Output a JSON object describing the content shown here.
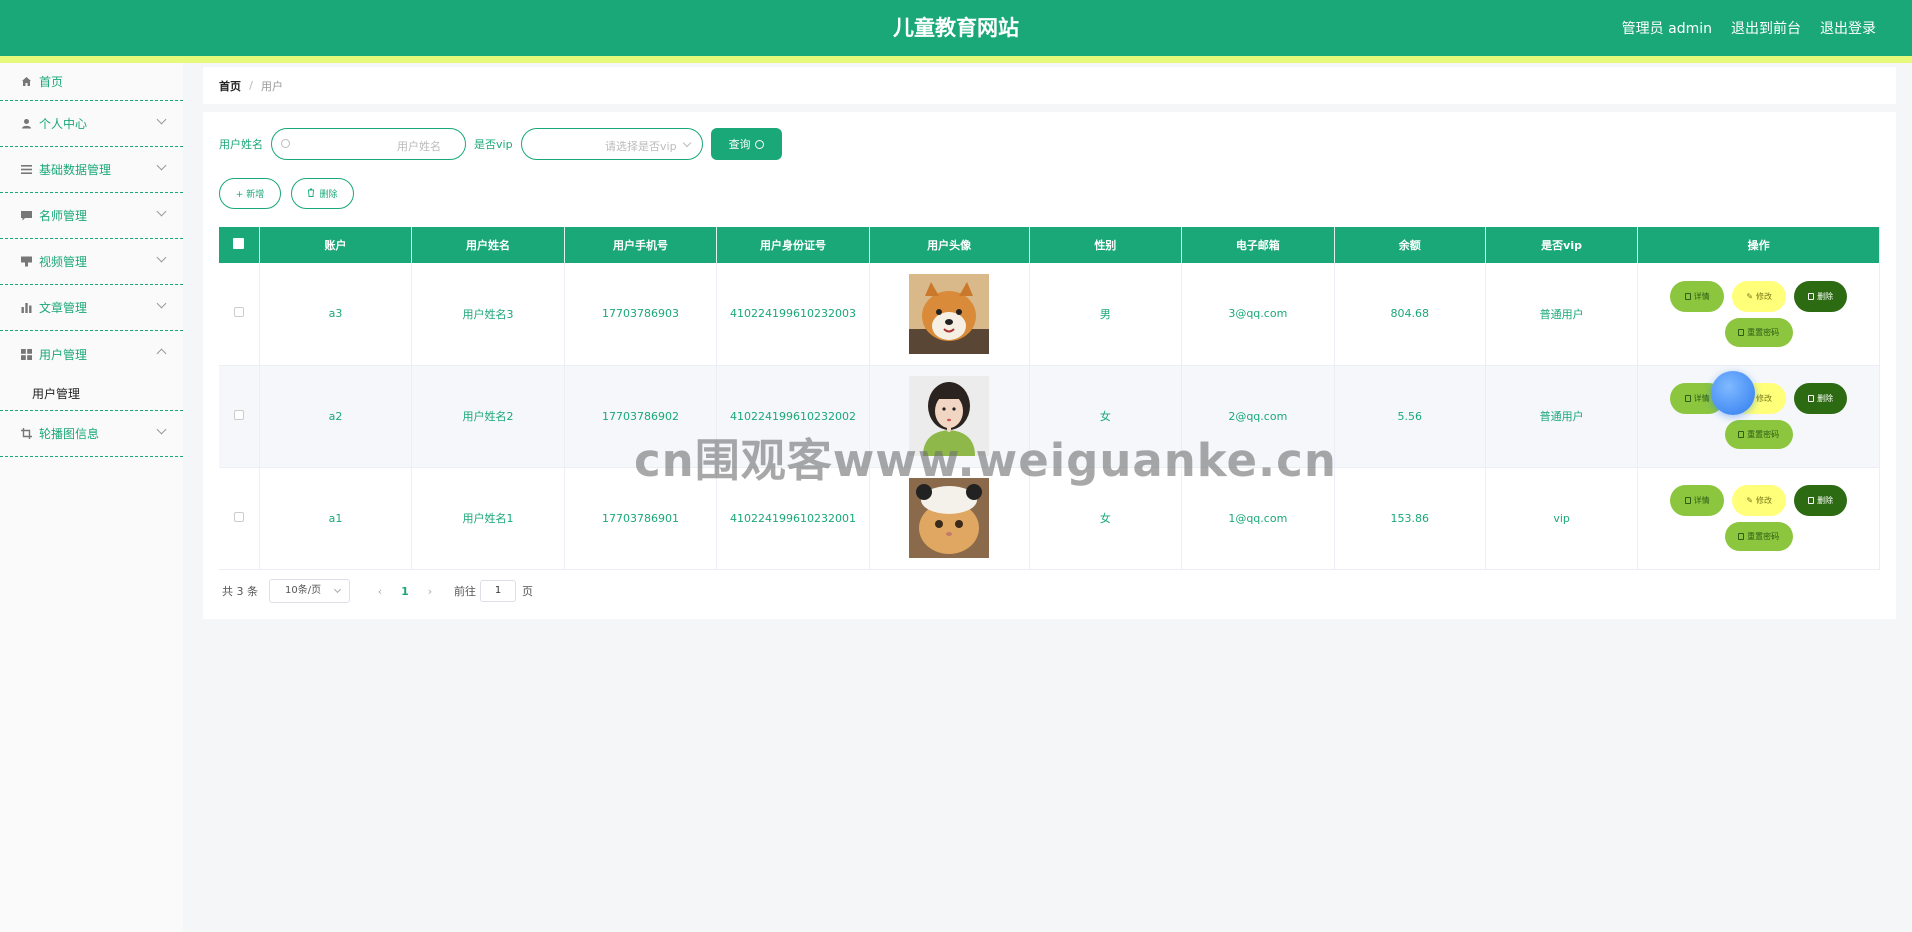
{
  "header": {
    "title": "儿童教育网站",
    "admin_label": "管理员 admin",
    "front_label": "退出到前台",
    "logout_label": "退出登录"
  },
  "sidebar": {
    "items": [
      {
        "label": "首页",
        "icon": "home-icon"
      },
      {
        "label": "个人中心",
        "icon": "user-icon"
      },
      {
        "label": "基础数据管理",
        "icon": "list-icon"
      },
      {
        "label": "名师管理",
        "icon": "chat-icon"
      },
      {
        "label": "视频管理",
        "icon": "video-icon"
      },
      {
        "label": "文章管理",
        "icon": "chart-icon"
      },
      {
        "label": "用户管理",
        "icon": "grid-icon",
        "expanded": true
      },
      {
        "label": "轮播图信息",
        "icon": "crop-icon"
      }
    ],
    "submenu_user": "用户管理"
  },
  "breadcrumb": {
    "home": "首页",
    "sep": "/",
    "current": "用户"
  },
  "search": {
    "name_label": "用户姓名",
    "name_placeholder": "用户姓名",
    "vip_label": "是否vip",
    "vip_placeholder": "请选择是否vip",
    "query_label": "查询"
  },
  "actions": {
    "add_label": "+ 新增",
    "delete_label": "删除"
  },
  "table": {
    "headers": [
      "账户",
      "用户姓名",
      "用户手机号",
      "用户身份证号",
      "用户头像",
      "性别",
      "电子邮箱",
      "余额",
      "是否vip",
      "操作"
    ],
    "rows": [
      {
        "account": "a3",
        "name": "用户姓名3",
        "phone": "17703786903",
        "idcard": "410224199610232003",
        "avatar": "shiba-dog-photo",
        "gender": "男",
        "email": "3@qq.com",
        "balance": "804.68",
        "vip": "普通用户"
      },
      {
        "account": "a2",
        "name": "用户姓名2",
        "phone": "17703786902",
        "idcard": "410224199610232002",
        "avatar": "girl-photo",
        "gender": "女",
        "email": "2@qq.com",
        "balance": "5.56",
        "vip": "普通用户"
      },
      {
        "account": "a1",
        "name": "用户姓名1",
        "phone": "17703786901",
        "idcard": "410224199610232001",
        "avatar": "cat-photo",
        "gender": "女",
        "email": "1@qq.com",
        "balance": "153.86",
        "vip": "vip"
      }
    ],
    "ops": {
      "detail": "详情",
      "edit": "修改",
      "delete": "删除",
      "reset": "重置密码"
    }
  },
  "pagination": {
    "total": "共 3 条",
    "page_size": "10条/页",
    "prev": "‹",
    "current": "1",
    "next": "›",
    "goto_label": "前往",
    "goto_value": "1",
    "page_unit": "页"
  },
  "watermark": "cn围观客www.weiguanke.cn",
  "colors": {
    "primary": "#1ba878",
    "stripe": "#e6f97a",
    "detail": "#8cc63f",
    "edit": "#ffff7a",
    "delete": "#2c6b12"
  }
}
